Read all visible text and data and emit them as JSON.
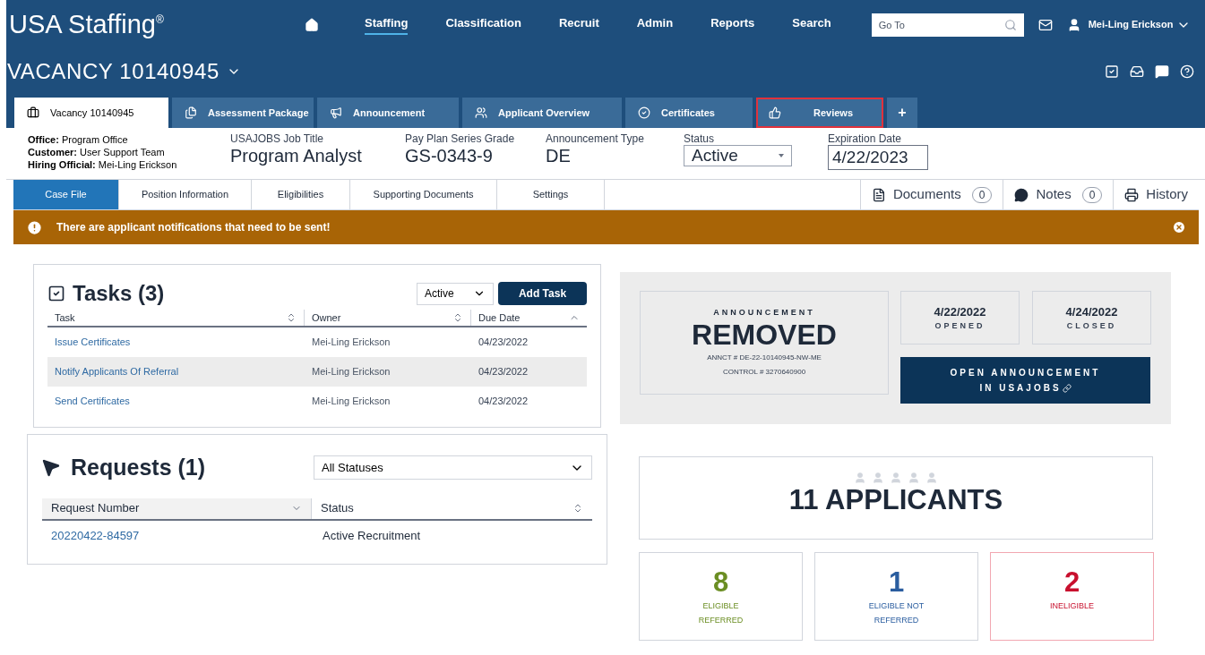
{
  "nav": {
    "logo": "USA Staffing",
    "logo_mark": "®",
    "items": [
      {
        "label": "Staffing",
        "selected": true
      },
      {
        "label": "Classification",
        "selected": false
      },
      {
        "label": "Recruit",
        "selected": false
      },
      {
        "label": "Admin",
        "selected": false
      },
      {
        "label": "Reports",
        "selected": false
      },
      {
        "label": "Search",
        "selected": false
      }
    ],
    "search": {
      "placeholder": "Go To"
    },
    "user": "Mei-Ling Erickson"
  },
  "vacancy": {
    "title": "VACANCY 10140945"
  },
  "tabs": [
    {
      "label": "Vacancy 10140945",
      "selected": true,
      "highlighted": false
    },
    {
      "label": "Assessment Package",
      "selected": false,
      "highlighted": false
    },
    {
      "label": "Announcement",
      "selected": false,
      "highlighted": false
    },
    {
      "label": "Applicant Overview",
      "selected": false,
      "highlighted": false
    },
    {
      "label": "Certificates",
      "selected": false,
      "highlighted": false
    },
    {
      "label": "Reviews",
      "selected": false,
      "highlighted": true
    }
  ],
  "add_tab": "+",
  "info": {
    "contacts": [
      {
        "label": "Office:",
        "value": "Program Office"
      },
      {
        "label": "Customer:",
        "value": "User Support Team"
      },
      {
        "label": "Hiring Official:",
        "value": "Mei-Ling Erickson"
      }
    ],
    "fields": [
      {
        "kind": "text",
        "label": "USAJOBS Job Title",
        "value": "Program Analyst"
      },
      {
        "kind": "text",
        "label": "Pay Plan Series Grade",
        "value": "GS-0343-9"
      },
      {
        "kind": "text",
        "label": "Announcement Type",
        "value": "DE"
      },
      {
        "kind": "select",
        "label": "Status",
        "value": "Active"
      },
      {
        "kind": "input",
        "label": "Expiration Date",
        "value": "4/22/2023"
      }
    ]
  },
  "steps": [
    {
      "label": "Case File",
      "selected": true
    },
    {
      "label": "Position Information",
      "selected": false
    },
    {
      "label": "Eligibilities",
      "selected": false
    },
    {
      "label": "Supporting Documents",
      "selected": false
    },
    {
      "label": "Settings",
      "selected": false
    }
  ],
  "side_buttons": [
    {
      "kind": "documents",
      "label": "Documents",
      "count": "0"
    },
    {
      "kind": "notes",
      "label": "Notes",
      "count": "0"
    },
    {
      "kind": "history",
      "label": "History"
    }
  ],
  "alert": {
    "text": "There are applicant notifications that need to be sent!"
  },
  "tasks": {
    "title": "Tasks (3)",
    "filter": "Active",
    "add_button": "Add Task",
    "columns": [
      {
        "label": "Task",
        "sorted": false
      },
      {
        "label": "Owner",
        "sorted": false
      },
      {
        "label": "Due Date",
        "sorted": true,
        "descending": false
      }
    ],
    "rows": [
      {
        "task": "Issue Certificates",
        "owner": "Mei-Ling Erickson",
        "due": "04/23/2022",
        "selected": false
      },
      {
        "task": "Notify Applicants Of Referral",
        "owner": "Mei-Ling Erickson",
        "due": "04/23/2022",
        "selected": true
      },
      {
        "task": "Send Certificates",
        "owner": "Mei-Ling Erickson",
        "due": "04/23/2022",
        "selected": false
      }
    ]
  },
  "requests": {
    "title": "Requests (1)",
    "filter": "All Statuses",
    "columns": [
      {
        "label": "Request Number",
        "sorted": true,
        "descending": true
      },
      {
        "label": "Status",
        "sorted": false
      }
    ],
    "rows": [
      {
        "number": "20220422-84597",
        "status": "Active Recruitment"
      }
    ]
  },
  "announcement": {
    "label": "ANNOUNCEMENT",
    "status": "REMOVED",
    "annct": "ANNCT # DE-22-10140945-NW-ME",
    "control": "CONTROL # 3270640900",
    "dates": [
      {
        "date": "4/22/2022",
        "label": "OPENED"
      },
      {
        "date": "4/24/2022",
        "label": "CLOSED"
      }
    ],
    "button": [
      "OPEN ANNOUNCEMENT",
      "IN USAJOBS"
    ]
  },
  "applicants": {
    "title": "11 APPLICANTS",
    "stats": [
      {
        "value": "8",
        "label": [
          "ELIGIBLE",
          "REFERRED"
        ],
        "color": "#6b8e23",
        "alert": false
      },
      {
        "value": "1",
        "label": [
          "ELIGIBLE NOT",
          "REFERRED"
        ],
        "color": "#2a5d9f",
        "alert": false
      },
      {
        "value": "2",
        "label": [
          "INELIGIBLE"
        ],
        "color": "#c8102e",
        "alert": true
      }
    ]
  }
}
